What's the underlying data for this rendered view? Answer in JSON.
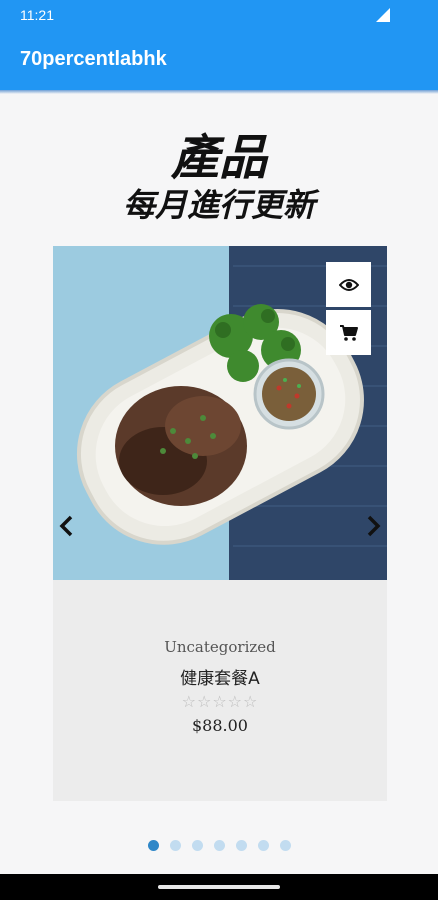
{
  "status_bar": {
    "time": "11:21"
  },
  "app_bar": {
    "title": "70percentlabhk"
  },
  "hero": {
    "title": "產品",
    "subtitle": "每月進行更新"
  },
  "product": {
    "category": "Uncategorized",
    "name": "健康套餐A",
    "rating": 0,
    "rating_max": 5,
    "stars_text": "☆☆☆☆☆",
    "price": "$88.00",
    "image_icon": "food-photo"
  },
  "actions": {
    "view_icon": "eye-icon",
    "cart_icon": "cart-icon"
  },
  "carousel": {
    "total_pages": 7,
    "current_page": 1
  },
  "colors": {
    "primary": "#2196f3",
    "dot_active": "#2f87c8",
    "dot_inactive": "#c2dcf0"
  }
}
